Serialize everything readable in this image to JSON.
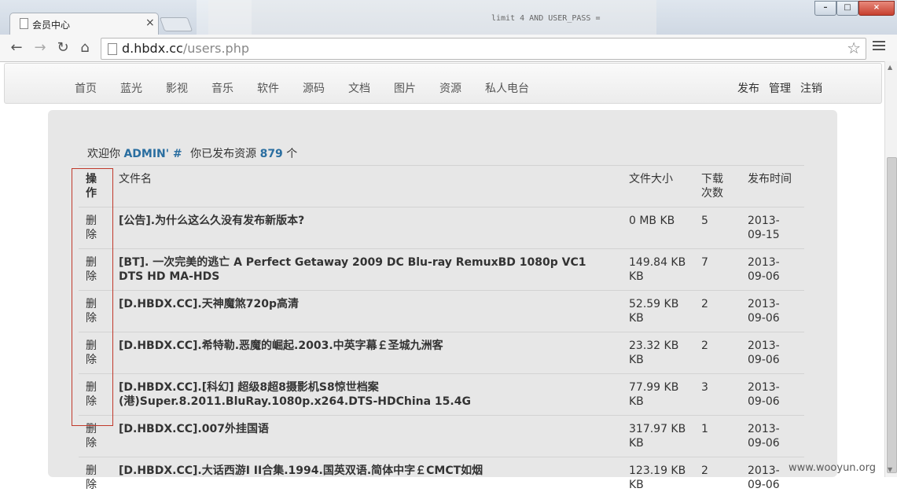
{
  "browser": {
    "tab_title": "会员中心",
    "tab_close": "×",
    "url_host": "d.hbdx.cc",
    "url_path": "/users.php",
    "nav_back": "←",
    "nav_forward": "→",
    "nav_reload": "↻",
    "nav_home": "⌂",
    "star": "☆"
  },
  "site_nav": {
    "left": [
      "首页",
      "蓝光",
      "影视",
      "音乐",
      "软件",
      "源码",
      "文档",
      "图片",
      "资源",
      "私人电台"
    ],
    "right": [
      "发布",
      "管理",
      "注销"
    ]
  },
  "welcome": {
    "prefix": "欢迎你",
    "user": "ADMIN' #",
    "middle": "你已发布资源",
    "count": "879",
    "suffix": "个"
  },
  "table": {
    "headers": {
      "action": [
        "操",
        "作"
      ],
      "filename": "文件名",
      "size": "文件大小",
      "downloads": [
        "下载",
        "次数"
      ],
      "date": "发布时间"
    },
    "rows": [
      {
        "action": [
          "删",
          "除"
        ],
        "name": [
          "[公告].为什么这么久没有发布新版本?"
        ],
        "size": [
          "0 MB KB"
        ],
        "downloads": "5",
        "date": [
          "2013-",
          "09-15"
        ]
      },
      {
        "action": [
          "删",
          "除"
        ],
        "name": [
          "[BT]. 一次完美的逃亡 A Perfect Getaway 2009 DC Blu-ray RemuxBD 1080p VC1",
          "DTS HD MA-HDS"
        ],
        "size": [
          "149.84 KB",
          "KB"
        ],
        "downloads": "7",
        "date": [
          "2013-",
          "09-06"
        ]
      },
      {
        "action": [
          "删",
          "除"
        ],
        "name": [
          "[D.HBDX.CC].天神魔煞720p高清"
        ],
        "size": [
          "52.59 KB",
          "KB"
        ],
        "downloads": "2",
        "date": [
          "2013-",
          "09-06"
        ]
      },
      {
        "action": [
          "删",
          "除"
        ],
        "name": [
          "[D.HBDX.CC].希特勒.恶魔的崛起.2003.中英字幕￡圣城九洲客"
        ],
        "size": [
          "23.32 KB",
          "KB"
        ],
        "downloads": "2",
        "date": [
          "2013-",
          "09-06"
        ]
      },
      {
        "action": [
          "删",
          "除"
        ],
        "name": [
          "[D.HBDX.CC].[科幻] 超级8超8摄影机S8惊世档案",
          "(港)Super.8.2011.BluRay.1080p.x264.DTS-HDChina 15.4G"
        ],
        "size": [
          "77.99 KB",
          "KB"
        ],
        "downloads": "3",
        "date": [
          "2013-",
          "09-06"
        ]
      },
      {
        "action": [
          "删",
          "除"
        ],
        "name": [
          "[D.HBDX.CC].007外挂国语"
        ],
        "size": [
          "317.97 KB",
          "KB"
        ],
        "downloads": "1",
        "date": [
          "2013-",
          "09-06"
        ]
      },
      {
        "action": [
          "删",
          "除"
        ],
        "name": [
          "[D.HBDX.CC].大话西游I II合集.1994.国英双语.简体中字￡CMCT如烟"
        ],
        "size": [
          "123.19 KB",
          "KB"
        ],
        "downloads": "2",
        "date": [
          "2013-",
          "09-06"
        ]
      }
    ]
  },
  "watermark": "www.wooyun.org",
  "colors": {
    "accent": "#2a6ea0",
    "highlight_box": "#c0392b"
  }
}
